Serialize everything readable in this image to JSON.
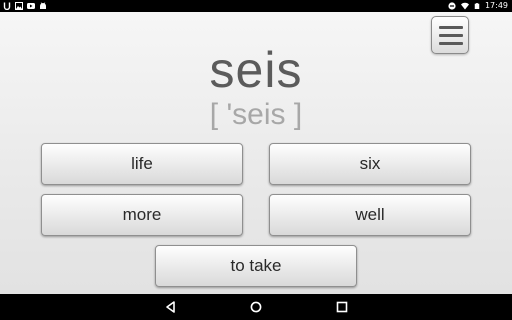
{
  "status_bar": {
    "time": "17:49",
    "left_icons": [
      "notification-u-icon",
      "image-icon",
      "youtube-icon",
      "android-icon"
    ],
    "right_icons": [
      "do-not-disturb-icon",
      "wifi-icon",
      "battery-icon"
    ]
  },
  "toolbar": {
    "menu_icon": "hamburger-menu-icon"
  },
  "quiz": {
    "word": "seis",
    "phonetic": "[ 'seis ]",
    "choices": [
      "life",
      "six",
      "more",
      "well",
      "to take"
    ]
  },
  "nav_bar": {
    "icons": [
      "back-icon",
      "home-icon",
      "recents-icon"
    ]
  }
}
